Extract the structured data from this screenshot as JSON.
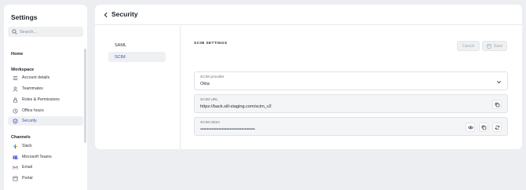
{
  "sidebar": {
    "title": "Settings",
    "search_placeholder": "Search...",
    "home_label": "Home",
    "workspace_heading": "Workspace",
    "workspace_items": [
      {
        "label": "Account details",
        "icon": "list-icon"
      },
      {
        "label": "Teammates",
        "icon": "person-icon"
      },
      {
        "label": "Roles & Permissions",
        "icon": "lock-icon"
      },
      {
        "label": "Office hours",
        "icon": "clock-icon"
      },
      {
        "label": "Security",
        "icon": "shield-icon",
        "active": true
      }
    ],
    "channels_heading": "Channels",
    "channel_items": [
      {
        "label": "Slack",
        "icon": "slack-icon"
      },
      {
        "label": "Microsoft Teams",
        "icon": "teams-icon"
      },
      {
        "label": "Email",
        "icon": "gmail-icon"
      },
      {
        "label": "Portal",
        "icon": "portal-icon"
      }
    ]
  },
  "header": {
    "title": "Security",
    "back_icon": "chevron-left-icon"
  },
  "subnav": {
    "items": [
      "SAML",
      "SCIM"
    ],
    "active": "SCIM"
  },
  "scim": {
    "section_title": "SCIM SETTINGS",
    "cancel_label": "Cancel",
    "save_label": "Save",
    "provider": {
      "label": "SCIM provider",
      "value": "Okta"
    },
    "url": {
      "label": "SCIM URL",
      "value": "https://back.sill-staging.com/scim_v2"
    },
    "token": {
      "label": "SCIM token",
      "value": "••••••••••••••••••••••••••••••••••••••••••••••••"
    }
  },
  "colors": {
    "accent": "#4353c4",
    "background": "#eceef1",
    "surface": "#ffffff"
  }
}
